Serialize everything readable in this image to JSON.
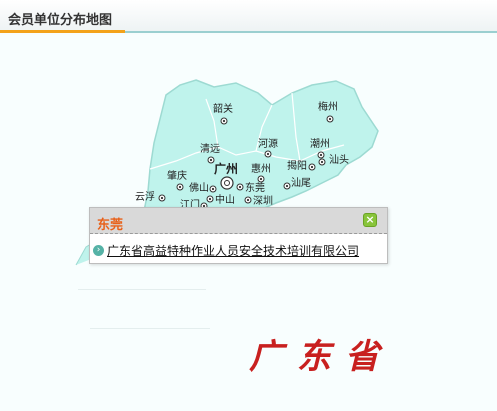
{
  "header": {
    "title": "会员单位分布地图"
  },
  "map": {
    "region_color": "#bff3ec",
    "border_color": "#9ddad2",
    "cities": [
      {
        "id": "shaoguan",
        "name": "韶关",
        "big": false
      },
      {
        "id": "meizhou",
        "name": "梅州",
        "big": false
      },
      {
        "id": "qingyuan",
        "name": "清远",
        "big": false
      },
      {
        "id": "heyuan",
        "name": "河源",
        "big": false
      },
      {
        "id": "chaozhou",
        "name": "潮州",
        "big": false
      },
      {
        "id": "guangzhou",
        "name": "广州",
        "big": true
      },
      {
        "id": "huizhou",
        "name": "惠州",
        "big": false
      },
      {
        "id": "jieyang",
        "name": "揭阳",
        "big": false
      },
      {
        "id": "shantou",
        "name": "汕头",
        "big": false
      },
      {
        "id": "zhaoqing",
        "name": "肇庆",
        "big": false
      },
      {
        "id": "foshan",
        "name": "佛山",
        "big": false
      },
      {
        "id": "dongguan",
        "name": "东莞",
        "big": false
      },
      {
        "id": "shanwei",
        "name": "汕尾",
        "big": false
      },
      {
        "id": "yunfu",
        "name": "云浮",
        "big": false
      },
      {
        "id": "zhongshan",
        "name": "中山",
        "big": false
      },
      {
        "id": "shenzhen",
        "name": "深圳",
        "big": false
      },
      {
        "id": "jiangmen",
        "name": "江门",
        "big": false
      }
    ],
    "province_label": "广东省"
  },
  "popup": {
    "title": "东莞",
    "close_icon": "close-icon",
    "items": [
      {
        "label": "广东省高益特种作业人员安全技术培训有限公司"
      }
    ]
  }
}
